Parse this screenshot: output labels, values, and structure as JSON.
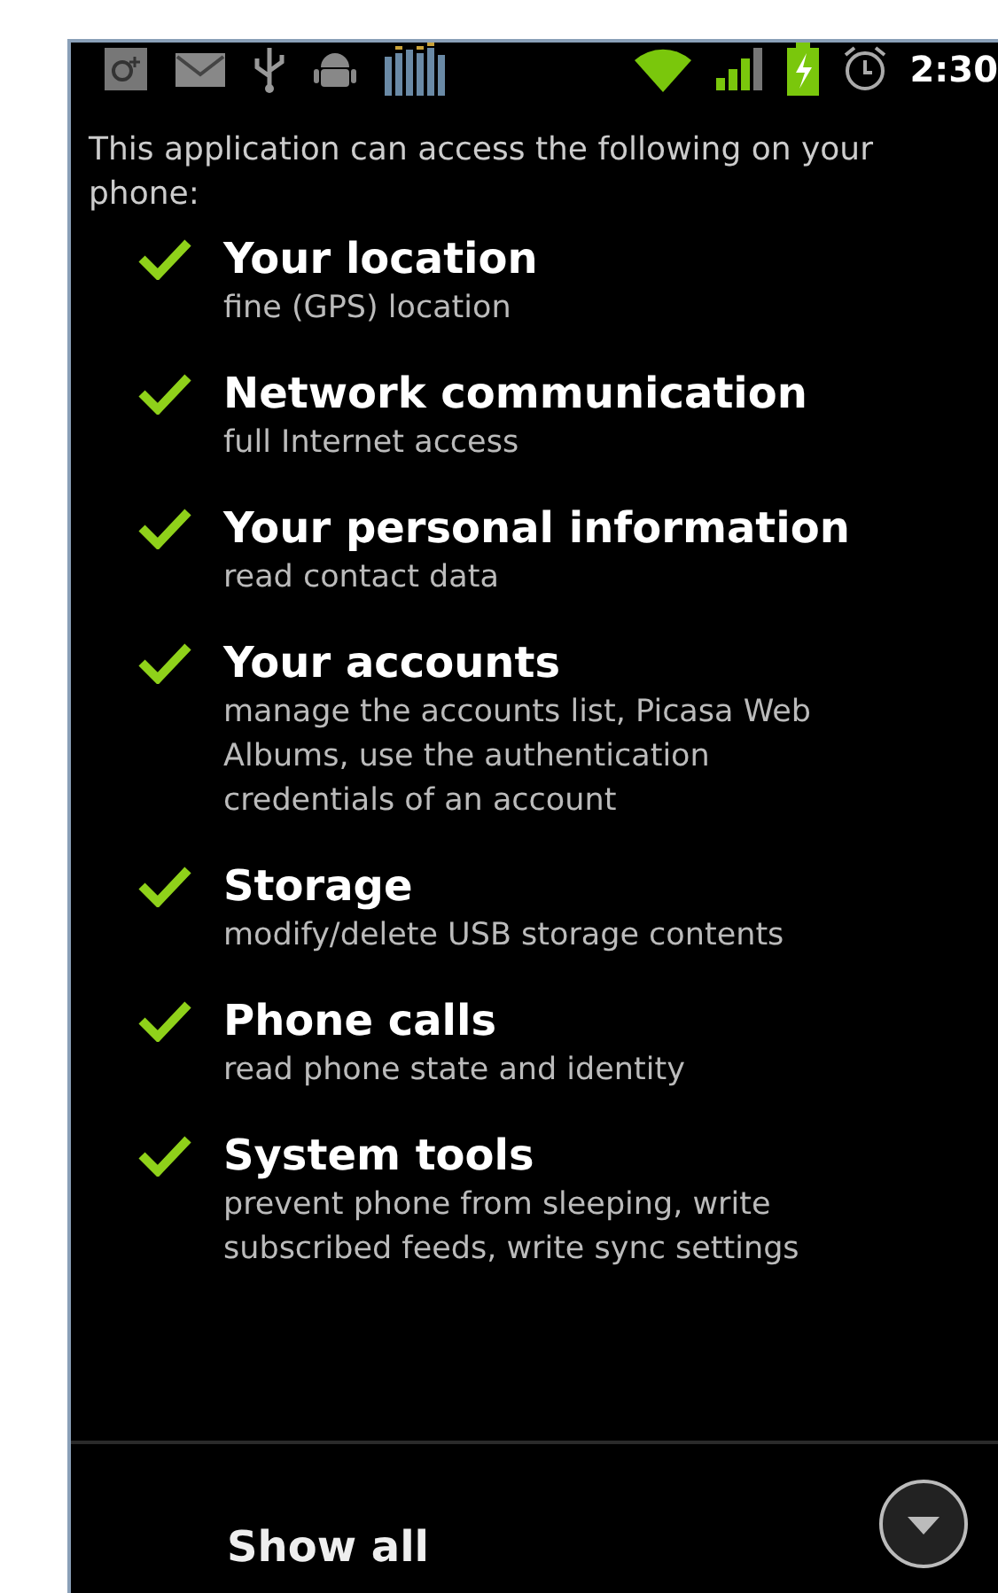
{
  "status_bar": {
    "time": "2:30"
  },
  "intro": "This application can access the following on your phone:",
  "permissions": [
    {
      "title": "Your location",
      "description": "fine (GPS) location"
    },
    {
      "title": "Network communication",
      "description": "full Internet access"
    },
    {
      "title": "Your personal information",
      "description": "read contact data"
    },
    {
      "title": "Your accounts",
      "description": "manage the accounts list, Picasa Web Albums, use the authentication credentials of an account"
    },
    {
      "title": "Storage",
      "description": "modify/delete USB storage contents"
    },
    {
      "title": "Phone calls",
      "description": "read phone state and identity"
    },
    {
      "title": "System tools",
      "description": "prevent phone from sleeping, write subscribed feeds, write sync settings"
    }
  ],
  "show_all": {
    "label": "Show all"
  }
}
